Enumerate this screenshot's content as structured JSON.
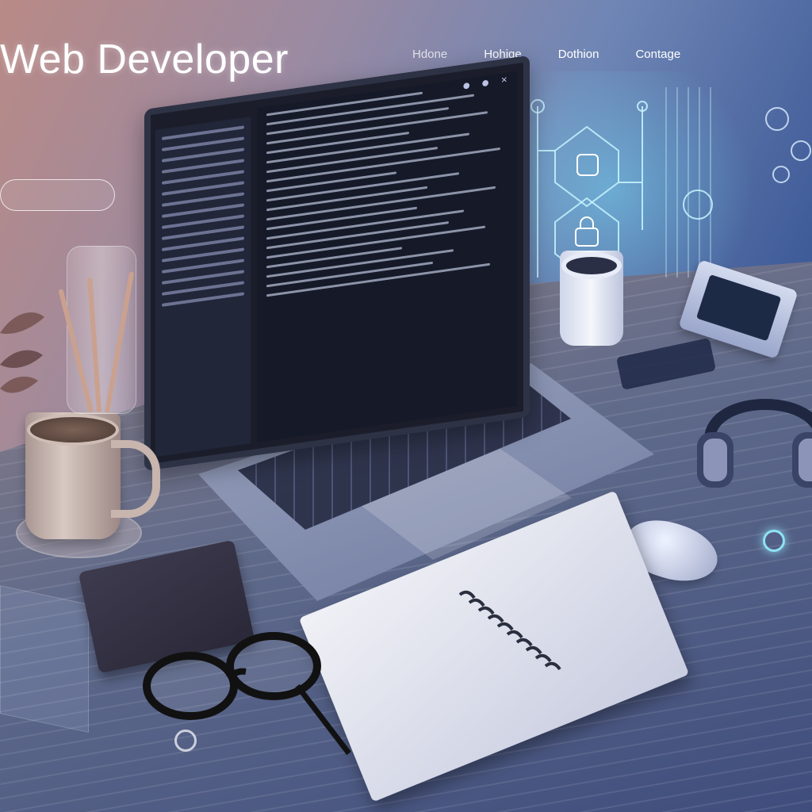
{
  "hero": {
    "title": "Web Developer",
    "description_lines": [
      "",
      "",
      ""
    ],
    "cta_label": ""
  },
  "nav": {
    "items": [
      "Hdone",
      "Hohige",
      "Dothion",
      "Contage"
    ]
  },
  "colors": {
    "accent_glow": "#78e6ff",
    "screen_bg": "#1b1e2a"
  },
  "icons": [
    "circuit-node-icon",
    "shield-icon",
    "lock-icon",
    "headphones-icon",
    "glasses-icon"
  ]
}
